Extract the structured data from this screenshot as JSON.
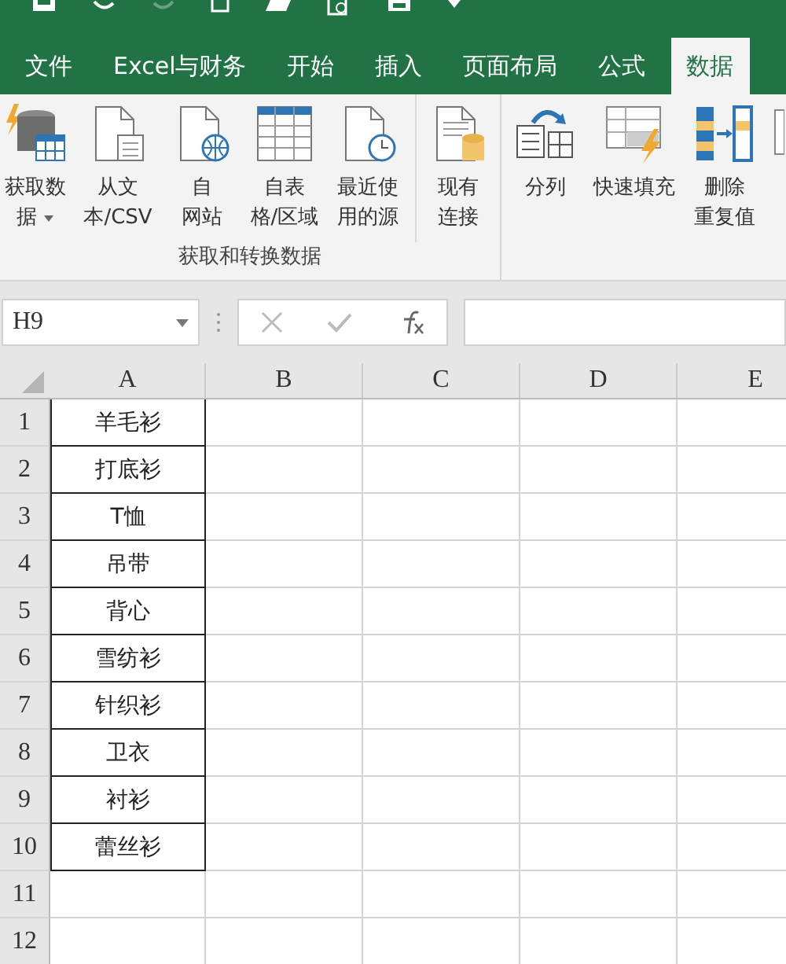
{
  "tabs": [
    {
      "label": "文件",
      "selected": false
    },
    {
      "label": "Excel与财务",
      "selected": false
    },
    {
      "label": "开始",
      "selected": false
    },
    {
      "label": "插入",
      "selected": false
    },
    {
      "label": "页面布局",
      "selected": false
    },
    {
      "label": "公式",
      "selected": false
    },
    {
      "label": "数据",
      "selected": true
    }
  ],
  "ribbon": {
    "groups": [
      {
        "label": "获取和转换数据",
        "buttons": [
          {
            "kind": "database",
            "lines": [
              "获取数",
              "据"
            ],
            "dropdown": true
          },
          {
            "kind": "textfile",
            "lines": [
              "从文",
              "本/CSV"
            ]
          },
          {
            "kind": "web",
            "lines": [
              "自",
              "网站"
            ]
          },
          {
            "kind": "table",
            "lines": [
              "自表",
              "格/区域"
            ]
          },
          {
            "kind": "recent",
            "lines": [
              "最近使",
              "用的源"
            ]
          },
          {
            "kind": "connections",
            "lines": [
              "现有",
              "连接"
            ],
            "separated": true
          }
        ]
      },
      {
        "buttons": [
          {
            "kind": "split",
            "lines": [
              "分列"
            ]
          },
          {
            "kind": "flashfill",
            "lines": [
              "快速填充"
            ]
          },
          {
            "kind": "dedupe",
            "lines": [
              "删除",
              "重复值"
            ]
          },
          {
            "kind": "cut"
          }
        ]
      }
    ]
  },
  "formula_bar": {
    "name_box": "H9"
  },
  "sheet": {
    "columns": [
      "A",
      "B",
      "C",
      "D",
      "E"
    ],
    "rows": [
      {
        "header": "1",
        "cells": [
          "羊毛衫"
        ]
      },
      {
        "header": "2",
        "cells": [
          "打底衫"
        ]
      },
      {
        "header": "3",
        "cells": [
          "T恤"
        ]
      },
      {
        "header": "4",
        "cells": [
          "吊带"
        ]
      },
      {
        "header": "5",
        "cells": [
          "背心"
        ]
      },
      {
        "header": "6",
        "cells": [
          "雪纺衫"
        ]
      },
      {
        "header": "7",
        "cells": [
          "针织衫"
        ]
      },
      {
        "header": "8",
        "cells": [
          "卫衣"
        ]
      },
      {
        "header": "9",
        "cells": [
          "衬衫"
        ]
      },
      {
        "header": "10",
        "cells": [
          "蕾丝衫"
        ]
      },
      {
        "header": "11"
      },
      {
        "header": "12"
      }
    ]
  }
}
